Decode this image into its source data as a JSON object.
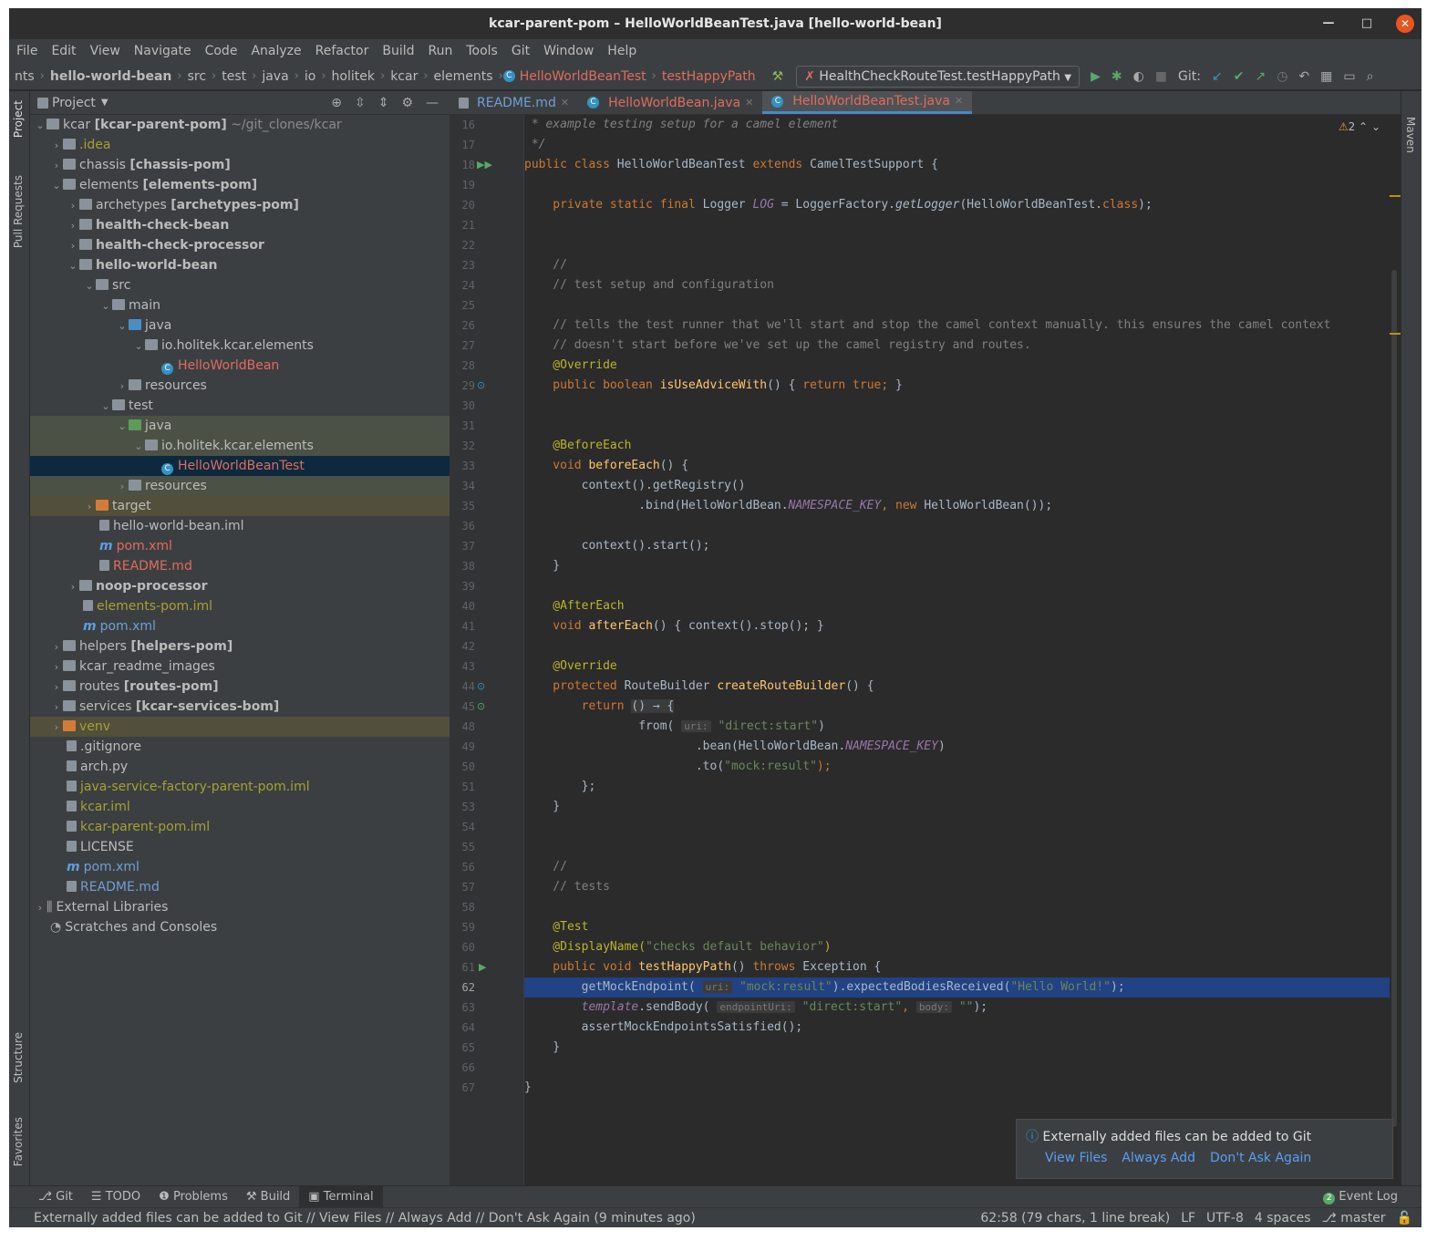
{
  "window": {
    "title": "kcar-parent-pom – HelloWorldBeanTest.java [hello-world-bean]"
  },
  "menu": [
    "File",
    "Edit",
    "View",
    "Navigate",
    "Code",
    "Analyze",
    "Refactor",
    "Build",
    "Run",
    "Tools",
    "Git",
    "Window",
    "Help"
  ],
  "breadcrumb": [
    "nts",
    "hello-world-bean",
    "src",
    "test",
    "java",
    "io",
    "holitek",
    "kcar",
    "elements",
    "HelloWorldBeanTest",
    "testHappyPath"
  ],
  "run_config": "HealthCheckRouteTest.testHappyPath",
  "git_label": "Git:",
  "project_panel": {
    "title": "Project"
  },
  "left_strip": [
    "Project",
    "Pull Requests",
    "Structure",
    "Favorites"
  ],
  "right_strip": [
    "Maven"
  ],
  "tree": [
    {
      "text": "kcar",
      "bold": "[kcar-parent-pom]",
      "extra": "~/git_clones/kcar"
    },
    {
      "text": ".idea"
    },
    {
      "text": "chassis",
      "bold": "[chassis-pom]"
    },
    {
      "text": "elements",
      "bold": "[elements-pom]"
    },
    {
      "text": "archetypes",
      "bold": "[archetypes-pom]"
    },
    {
      "text": "health-check-bean"
    },
    {
      "text": "health-check-processor"
    },
    {
      "text": "hello-world-bean"
    },
    {
      "text": "src"
    },
    {
      "text": "main"
    },
    {
      "text": "java"
    },
    {
      "text": "io.holitek.kcar.elements"
    },
    {
      "text": "HelloWorldBean"
    },
    {
      "text": "resources"
    },
    {
      "text": "test"
    },
    {
      "text": "java"
    },
    {
      "text": "io.holitek.kcar.elements"
    },
    {
      "text": "HelloWorldBeanTest"
    },
    {
      "text": "resources"
    },
    {
      "text": "target"
    },
    {
      "text": "hello-world-bean.iml"
    },
    {
      "text": "pom.xml"
    },
    {
      "text": "README.md"
    },
    {
      "text": "noop-processor"
    },
    {
      "text": "elements-pom.iml"
    },
    {
      "text": "pom.xml"
    },
    {
      "text": "helpers",
      "bold": "[helpers-pom]"
    },
    {
      "text": "kcar_readme_images"
    },
    {
      "text": "routes",
      "bold": "[routes-pom]"
    },
    {
      "text": "services",
      "bold": "[kcar-services-bom]"
    },
    {
      "text": "venv"
    },
    {
      "text": ".gitignore"
    },
    {
      "text": "arch.py"
    },
    {
      "text": "java-service-factory-parent-pom.iml"
    },
    {
      "text": "kcar.iml"
    },
    {
      "text": "kcar-parent-pom.iml"
    },
    {
      "text": "LICENSE"
    },
    {
      "text": "pom.xml"
    },
    {
      "text": "README.md"
    },
    {
      "text": "External Libraries"
    },
    {
      "text": "Scratches and Consoles"
    }
  ],
  "tabs": [
    "README.md",
    "HelloWorldBean.java",
    "HelloWorldBeanTest.java"
  ],
  "line_numbers": [
    "16",
    "17",
    "18",
    "19",
    "20",
    "21",
    "22",
    "23",
    "24",
    "25",
    "26",
    "27",
    "28",
    "29",
    "30",
    "31",
    "32",
    "33",
    "34",
    "35",
    "36",
    "37",
    "38",
    "39",
    "40",
    "41",
    "42",
    "43",
    "44",
    "45",
    "48",
    "49",
    "50",
    "51",
    "53",
    "54",
    "55",
    "56",
    "57",
    "58",
    "59",
    "60",
    "61",
    "62",
    "63",
    "64",
    "65",
    "66",
    "67"
  ],
  "code": {
    "l16": " * example testing setup for a camel element",
    "l17": " */",
    "l18a": "public class ",
    "l18b": "HelloWorldBeanTest ",
    "l18c": "extends ",
    "l18d": "CamelTestSupport {",
    "l20a": "    private static final ",
    "l20b": "Logger ",
    "l20c": "LOG",
    "l20d": " = LoggerFactory.",
    "l20e": "getLogger",
    "l20f": "(HelloWorldBeanTest.",
    "l20g": "class",
    "l20h": ");",
    "l23": "    //",
    "l24": "    // test setup and configuration",
    "l26": "    // tells the test runner that we'll start and stop the camel context manually. this ensures the camel context",
    "l27": "    // doesn't start before we've set up the camel registry and routes.",
    "l28": "    @Override",
    "l29a": "    public boolean ",
    "l29b": "isUseAdviceWith",
    "l29c": "() { ",
    "l29d": "return true;",
    "l29e": " }",
    "l32": "    @BeforeEach",
    "l33a": "    void ",
    "l33b": "beforeEach",
    "l33c": "() {",
    "l34": "        context().getRegistry()",
    "l35a": "                .bind(HelloWorldBean.",
    "l35b": "NAMESPACE_KEY",
    "l35c": ", ",
    "l35d": "new ",
    "l35e": "HelloWorldBean());",
    "l37": "        context().start();",
    "l38": "    }",
    "l40": "    @AfterEach",
    "l41a": "    void ",
    "l41b": "afterEach",
    "l41c": "() { context().stop(); }",
    "l43": "    @Override",
    "l44a": "    protected ",
    "l44b": "RouteBuilder ",
    "l44c": "createRouteBuilder",
    "l44d": "() {",
    "l45a": "        return ",
    "l45b": "() → {",
    "l48a": "                from( ",
    "l48h": "uri:",
    "l48b": " \"direct:start\"",
    "l48c": ")",
    "l49a": "                        .bean(HelloWorldBean.",
    "l49b": "NAMESPACE_KEY",
    "l49c": ")",
    "l50a": "                        .to(",
    "l50b": "\"mock:result\"",
    "l50c": ");",
    "l51": "        };",
    "l53": "    }",
    "l56": "    //",
    "l57": "    // tests",
    "l59": "    @Test",
    "l60a": "    @DisplayName(",
    "l60b": "\"checks default behavior\"",
    "l60c": ")",
    "l61a": "    public void ",
    "l61b": "testHappyPath",
    "l61c": "() ",
    "l61d": "throws ",
    "l61e": "Exception {",
    "l62a": "        getMockEndpoint( ",
    "l62h": "uri:",
    "l62b": " \"mock:result\"",
    "l62c": ").expectedBodiesReceived(",
    "l62d": "\"Hello World!\"",
    "l62e": ");",
    "l63a": "        template",
    "l63b": ".sendBody( ",
    "l63h": "endpointUri:",
    "l63c": " \"direct:start\"",
    "l63d": ", ",
    "l63h2": "body:",
    "l63e": " \"\"",
    "l63f": ");",
    "l64": "        assertMockEndpointsSatisfied();",
    "l65": "    }",
    "l67": "}"
  },
  "warnings": "2",
  "notification": {
    "text": "Externally added files can be added to Git",
    "links": [
      "View Files",
      "Always Add",
      "Don't Ask Again"
    ]
  },
  "tool_windows": [
    "Git",
    "TODO",
    "Problems",
    "Build",
    "Terminal"
  ],
  "event_log": {
    "count": "2",
    "label": "Event Log"
  },
  "status": {
    "message": "Externally added files can be added to Git // View Files // Always Add // Don't Ask Again (9 minutes ago)",
    "position": "62:58 (79 chars, 1 line break)",
    "line_sep": "LF",
    "encoding": "UTF-8",
    "indent": "4 spaces",
    "branch": "master"
  }
}
